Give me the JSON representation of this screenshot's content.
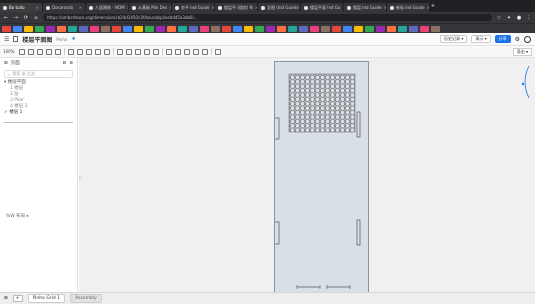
{
  "browser": {
    "tabs": [
      {
        "label": "Bo tudo"
      },
      {
        "label": "Dosarosdo"
      },
      {
        "label": "人居建筑 - NOM"
      },
      {
        "label": "从基础 Min Des"
      },
      {
        "label": "亦平 Ind Guide"
      },
      {
        "label": "楼层平 (楼房) N"
      },
      {
        "label": "总图 (Ind Guide)"
      },
      {
        "label": "楼层平面 Ind Gu"
      },
      {
        "label": "楼层 Ind Guide"
      },
      {
        "label": "新标 Ind Guide"
      }
    ],
    "url": "https://ambertown.org/dimension/cb24d3450c3f/boundspi/acbd45a3ab0/..."
  },
  "app": {
    "title": "楼层平面图",
    "subtitle": "Pinho",
    "right_buttons": [
      "共享"
    ],
    "share_label": "分享",
    "plain_buttons": [
      "历史记录 ▾",
      "演示 ▾"
    ]
  },
  "toolbar": {
    "zoom_label": "100%",
    "mode_label": "导出 ▾"
  },
  "sidebar": {
    "header": "页面",
    "search_placeholder": "搜索 或 过滤",
    "tree_root": "楼层平面",
    "tree_items": [
      "1 楼层",
      "2 层",
      "3 Pilar",
      "4 楼层 2"
    ],
    "tree_selected": "楼层 1",
    "footer_label": "%W 布局 ▸"
  },
  "status": {
    "add_label": "+",
    "tabs": [
      "Pinho Grid 1",
      "Assembly"
    ]
  },
  "colors": {
    "accent": "#1a73e8",
    "page_fill": "#d9dfe6",
    "tab_bar": "#202124"
  }
}
